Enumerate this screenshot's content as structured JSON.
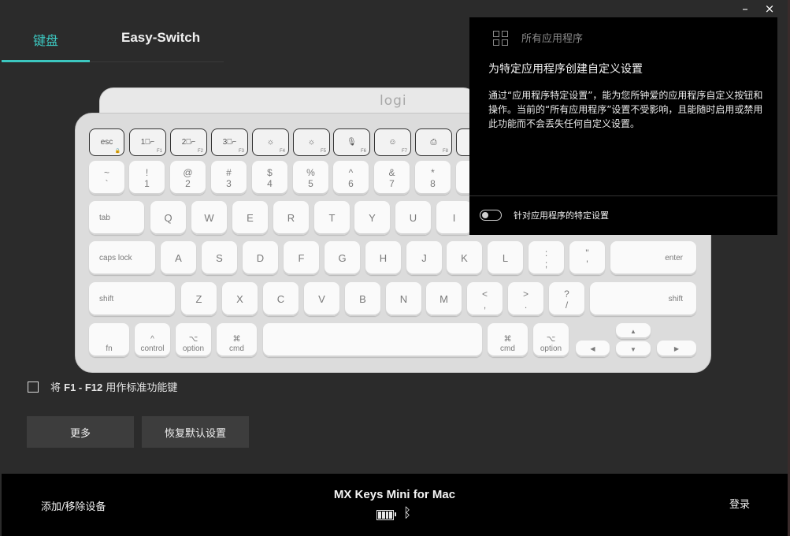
{
  "window": {
    "minimize": "–",
    "close": "×"
  },
  "tabs": {
    "keyboard": "键盘",
    "easy_switch": "Easy-Switch"
  },
  "keyboard": {
    "logo": "logi",
    "row_fn": [
      {
        "label": "esc",
        "sub": "🔒"
      },
      {
        "label": "1⎕⌐",
        "sub": "F1"
      },
      {
        "label": "2⎕⌐",
        "sub": "F2"
      },
      {
        "label": "3⎕⌐",
        "sub": "F3"
      },
      {
        "label": "☼",
        "sub": "F4"
      },
      {
        "label": "☼",
        "sub": "F5"
      },
      {
        "label": "🎙",
        "sub": "F6"
      },
      {
        "label": "☺",
        "sub": "F7"
      },
      {
        "label": "⎙",
        "sub": "F8"
      },
      {
        "label": "",
        "sub": ""
      }
    ],
    "row_num": [
      {
        "top": "~",
        "bottom": "`"
      },
      {
        "top": "!",
        "bottom": "1"
      },
      {
        "top": "@",
        "bottom": "2"
      },
      {
        "top": "#",
        "bottom": "3"
      },
      {
        "top": "$",
        "bottom": "4"
      },
      {
        "top": "%",
        "bottom": "5"
      },
      {
        "top": "^",
        "bottom": "6"
      },
      {
        "top": "&",
        "bottom": "7"
      },
      {
        "top": "*",
        "bottom": "8"
      },
      {
        "top": "",
        "bottom": ""
      }
    ],
    "tab": "tab",
    "row_q": [
      "Q",
      "W",
      "E",
      "R",
      "T",
      "Y",
      "U",
      "I"
    ],
    "caps": "caps lock",
    "row_a": [
      "A",
      "S",
      "D",
      "F",
      "G",
      "H",
      "J",
      "K",
      "L"
    ],
    "semicolon": {
      "top": ":",
      "bottom": ";"
    },
    "quote": {
      "top": "\"",
      "bottom": "'"
    },
    "enter": "enter",
    "shift_left": "shift",
    "row_z": [
      "Z",
      "X",
      "C",
      "V",
      "B",
      "N",
      "M"
    ],
    "comma": {
      "top": "<",
      "bottom": ","
    },
    "period": {
      "top": ">",
      "bottom": "."
    },
    "slash": {
      "top": "?",
      "bottom": "/"
    },
    "shift_right": "shift",
    "fn": "fn",
    "control": {
      "sym": "^",
      "label": "control"
    },
    "option_left": {
      "sym": "⌥",
      "label": "option"
    },
    "cmd_left": {
      "sym": "⌘",
      "label": "cmd"
    },
    "cmd_right": {
      "sym": "⌘",
      "label": "cmd"
    },
    "option_right": {
      "sym": "⌥",
      "label": "option"
    },
    "arrows": {
      "up": "▲",
      "down": "▼",
      "left": "◀",
      "right": "▶"
    }
  },
  "panel": {
    "header": "所有应用程序",
    "title": "为特定应用程序创建自定义设置",
    "description": "通过“应用程序特定设置”，能为您所钟爱的应用程序自定义按钮和操作。当前的“所有应用程序”设置不受影响，且能随时启用或禁用此功能而不会丢失任何自定义设置。",
    "toggle_label": "针对应用程序的特定设置",
    "toggle_on": false
  },
  "fkeys_option": {
    "prefix": "将 ",
    "keys": "F1 - F12",
    "suffix": " 用作标准功能键",
    "checked": false
  },
  "buttons": {
    "more": "更多",
    "reset": "恢复默认设置"
  },
  "footer": {
    "add_remove": "添加/移除设备",
    "device_name": "MX Keys Mini for Mac",
    "login": "登录",
    "bluetooth": "ᛒ"
  }
}
